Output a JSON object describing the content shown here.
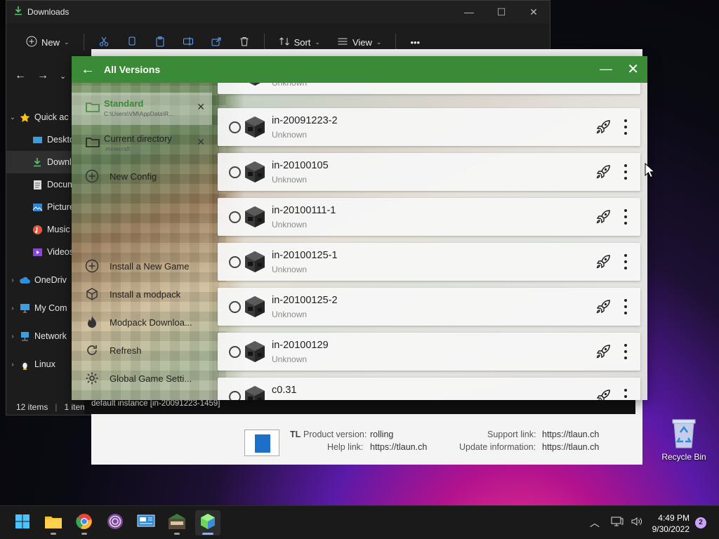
{
  "explorer": {
    "title": "Downloads",
    "window_controls": [
      "—",
      "☐",
      "✕"
    ],
    "toolbar": {
      "new_label": "New",
      "sort_label": "Sort",
      "view_label": "View",
      "more_label": "•••"
    },
    "sidebar": [
      {
        "label": "Quick ac",
        "caret": "⌄"
      },
      {
        "label": "Deskto"
      },
      {
        "label": "Downl"
      },
      {
        "label": "Docum"
      },
      {
        "label": "Picture"
      },
      {
        "label": "Music"
      },
      {
        "label": "Videos"
      },
      {
        "label": "OneDriv",
        "caret": "›"
      },
      {
        "label": "My Com",
        "caret": "›"
      },
      {
        "label": "Network",
        "caret": "›"
      },
      {
        "label": "Linux",
        "caret": "›"
      }
    ],
    "status": {
      "count": "12 items",
      "selected": "1 item"
    }
  },
  "background": {
    "strip_text": "default instance [in-20091223-1459]",
    "product_label": "TL",
    "product_version_key": "Product version:",
    "product_version_val": "rolling",
    "help_link_key": "Help link:",
    "help_link_val": "https://tlaun.ch",
    "support_link_key": "Support link:",
    "support_link_val": "https://tlaun.ch",
    "update_info_key": "Update information:",
    "update_info_val": "https://tlaun.ch"
  },
  "dialog": {
    "title": "All Versions",
    "configs": [
      {
        "name": "Standard",
        "path": "C:\\Users\\VM\\AppData\\R...",
        "selected": true
      },
      {
        "name": "Current directory",
        "path": ".minecraft",
        "selected": false
      }
    ],
    "new_config_label": "New Config",
    "actions": [
      {
        "label": "Install a New Game",
        "icon": "plus-circle-icon"
      },
      {
        "label": "Install a modpack",
        "icon": "package-icon"
      },
      {
        "label": "Modpack Downloa...",
        "icon": "fire-icon"
      },
      {
        "label": "Refresh",
        "icon": "refresh-icon"
      },
      {
        "label": "Global Game Setti...",
        "icon": "gear-icon"
      }
    ],
    "versions": [
      {
        "name": "",
        "status": "Unknown"
      },
      {
        "name": "in-20091223-2",
        "status": "Unknown"
      },
      {
        "name": "in-20100105",
        "status": "Unknown"
      },
      {
        "name": "in-20100111-1",
        "status": "Unknown"
      },
      {
        "name": "in-20100125-1",
        "status": "Unknown"
      },
      {
        "name": "in-20100125-2",
        "status": "Unknown"
      },
      {
        "name": "in-20100129",
        "status": "Unknown"
      },
      {
        "name": "c0.31",
        "status": ""
      }
    ]
  },
  "desktop": {
    "recycle_bin_label": "Recycle Bin"
  },
  "taskbar": {
    "apps": [
      "start-icon",
      "file-explorer-icon",
      "chrome-icon",
      "tor-icon",
      "control-panel-icon",
      "retro-game-icon",
      "launcher-icon"
    ],
    "time": "4:49 PM",
    "date": "9/30/2022",
    "notifications": "2"
  },
  "colors": {
    "accent_green": "#3b8a37",
    "taskbar": "#1a1a1a"
  }
}
